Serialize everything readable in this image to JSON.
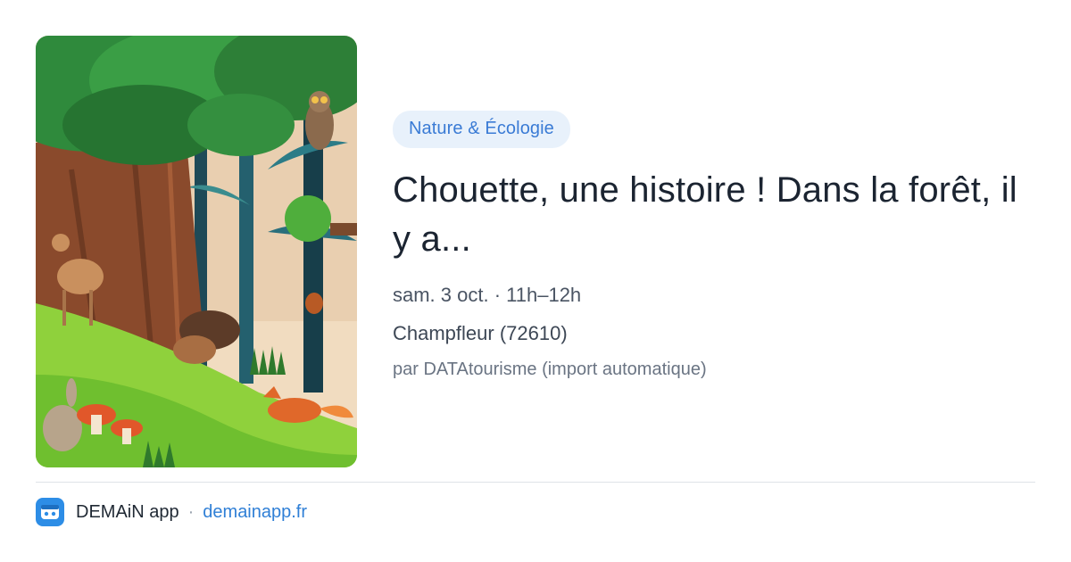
{
  "event": {
    "category": "Nature & Écologie",
    "title": "Chouette, une histoire ! Dans la forêt, il y a...",
    "datetime": "sam. 3 oct. · 11h–12h",
    "location": "Champfleur (72610)",
    "source": "par DATAtourisme (import automatique)"
  },
  "image": {
    "subject": "forest-illustration",
    "elements": [
      "trees",
      "owl",
      "deer",
      "boar",
      "piglet",
      "squirrel",
      "rabbit",
      "fox",
      "mushrooms",
      "grass"
    ]
  },
  "footer": {
    "app_name": "DEMAiN app",
    "separator": "·",
    "link": "demainapp.fr",
    "logo_icon": "app-logo-icon"
  },
  "colors": {
    "pill_bg": "#e8f1fb",
    "pill_text": "#3a7bd5",
    "title_text": "#1b2431",
    "link": "#2f7fd6",
    "logo_bg": "#2d8de6"
  }
}
